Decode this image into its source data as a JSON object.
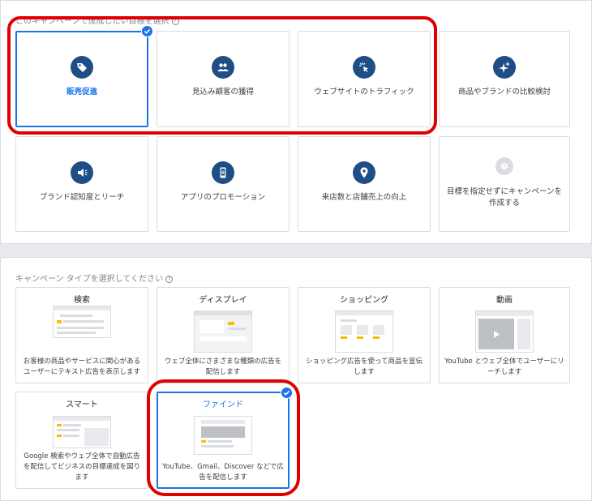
{
  "goals": {
    "heading": "このキャンペーンで達成したい目標を選択",
    "items": [
      {
        "label": "販売促進",
        "icon": "tag-icon"
      },
      {
        "label": "見込み顧客の獲得",
        "icon": "people-icon"
      },
      {
        "label": "ウェブサイトのトラフィック",
        "icon": "cursor-click-icon"
      },
      {
        "label": "商品やブランドの比較検討",
        "icon": "sparkle-icon"
      },
      {
        "label": "ブランド認知度とリーチ",
        "icon": "megaphone-icon"
      },
      {
        "label": "アプリのプロモーション",
        "icon": "smartphone-icon"
      },
      {
        "label": "来店数と店舗売上の向上",
        "icon": "location-pin-icon"
      },
      {
        "label": "目標を指定せずにキャンペーンを作成する",
        "icon": "gear-icon"
      }
    ],
    "selected": "販売促進"
  },
  "campaign_types": {
    "heading": "キャンペーン タイプを選択してください",
    "items": [
      {
        "title": "検索",
        "desc": "お客様の商品やサービスに関心があるユーザーにテキスト広告を表示します"
      },
      {
        "title": "ディスプレイ",
        "desc": "ウェブ全体にさまざまな種類の広告を配信します"
      },
      {
        "title": "ショッピング",
        "desc": "ショッピング広告を使って商品を宣伝します"
      },
      {
        "title": "動画",
        "desc": "YouTube とウェブ全体でユーザーにリーチします"
      },
      {
        "title": "スマート",
        "desc": "Google 検索やウェブ全体で自動広告を配信してビジネスの目標達成を図ります"
      },
      {
        "title": "ファインド",
        "desc": "YouTube、Gmail、Discover などで広告を配信します"
      }
    ],
    "selected": "ファインド"
  },
  "colors": {
    "accent": "#1a73e8",
    "icon_bg": "#1f4e87",
    "highlight": "#e00000"
  }
}
